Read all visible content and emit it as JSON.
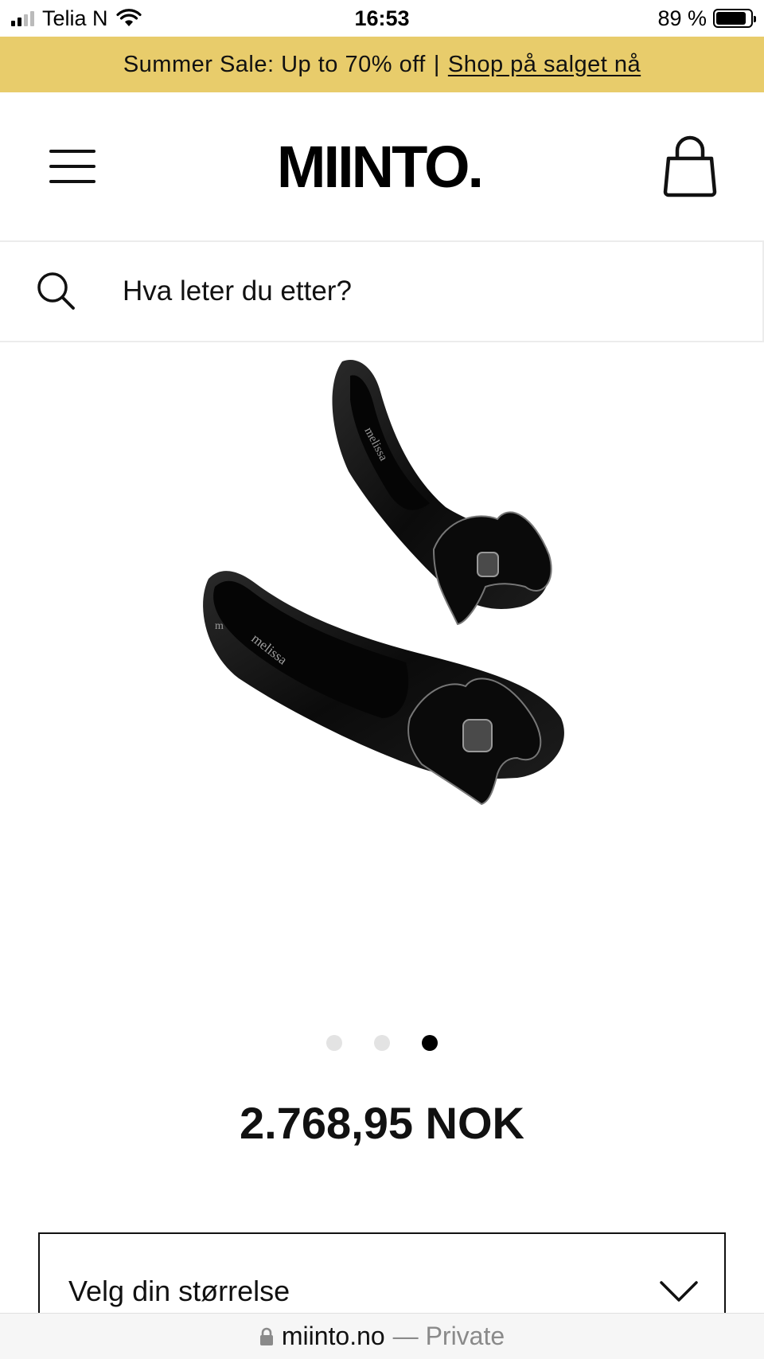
{
  "status_bar": {
    "carrier": "Telia N",
    "time": "16:53",
    "battery": "89 %",
    "battery_level": 0.89
  },
  "promo": {
    "text": "Summer Sale: Up to 70% off",
    "separator": "|",
    "link": "Shop på salget nå",
    "background": "#e8cc6b"
  },
  "header": {
    "logo": "MIINTO.",
    "icons": [
      "hamburger-menu-icon",
      "shopping-bag-icon"
    ]
  },
  "search": {
    "placeholder": "Hva leter du etter?",
    "icon": "search-icon"
  },
  "product": {
    "image_alt": "melissa",
    "carousel": {
      "count": 3,
      "active_index": 2
    },
    "price": "2.768,95 NOK",
    "size_select": {
      "label": "Velg din størrelse",
      "icon": "chevron-down-icon"
    }
  },
  "browser": {
    "url": "miinto.no",
    "mode": "— Private",
    "icon": "lock-icon"
  }
}
